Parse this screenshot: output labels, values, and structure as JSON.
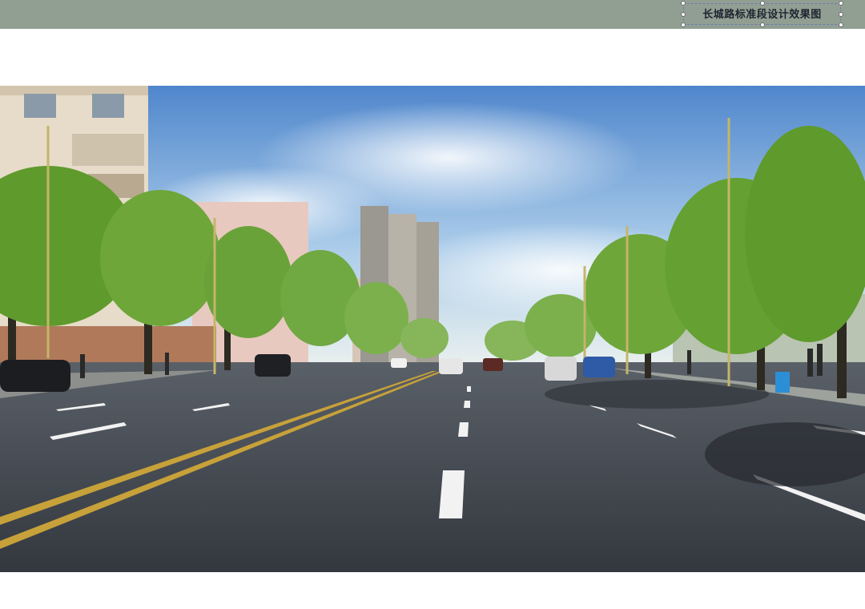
{
  "header": {
    "title": "长城路标准段设计效果图",
    "bar_color": "#919f93"
  },
  "scene": {
    "image": "street-rendering",
    "sky_color": "#6a9ed8",
    "road_color": "#3b4047",
    "tree_color": "#5f9a2c",
    "center_line_color": "#c7a13a"
  }
}
